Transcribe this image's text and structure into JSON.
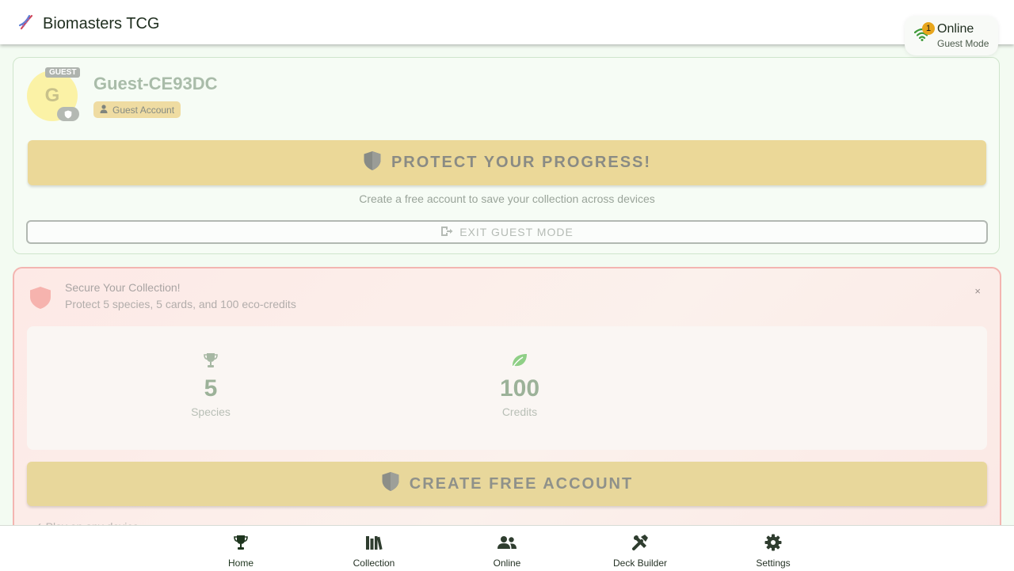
{
  "header": {
    "app_title": "Biomasters TCG",
    "logo_icon": "dna-icon",
    "status": {
      "notification_count": "1",
      "connection_label": "Online",
      "mode_label": "Guest Mode",
      "icon": "wifi-icon"
    }
  },
  "profile": {
    "avatar_letter": "G",
    "guest_tag": "GUEST",
    "username": "Guest-CE93DC",
    "account_chip": "Guest Account",
    "protect_button": "PROTECT YOUR PROGRESS!",
    "protect_subtext": "Create a free account to save your collection across devices",
    "exit_button": "EXIT GUEST MODE"
  },
  "secure_card": {
    "title": "Secure Your Collection!",
    "description": "Protect 5 species, 5 cards, and 100 eco-credits",
    "close_label": "×",
    "stats": [
      {
        "value": "5",
        "label": "Species",
        "icon": "trophy-icon"
      },
      {
        "value": "100",
        "label": "Credits",
        "icon": "leaf-icon"
      }
    ],
    "create_button": "CREATE FREE ACCOUNT",
    "benefit": "✓ Play on any device"
  },
  "bottom_nav": {
    "active": "Home",
    "items": [
      {
        "label": "Home",
        "icon": "trophy-icon"
      },
      {
        "label": "Collection",
        "icon": "library-icon"
      },
      {
        "label": "Online",
        "icon": "users-icon"
      },
      {
        "label": "Deck Builder",
        "icon": "tools-icon"
      },
      {
        "label": "Settings",
        "icon": "gear-icon"
      }
    ]
  },
  "colors": {
    "brand_green": "#1e351e",
    "accent_yellow": "#ebd898",
    "warning_border": "#f3b5b1",
    "badge_orange": "#e8a61c"
  }
}
